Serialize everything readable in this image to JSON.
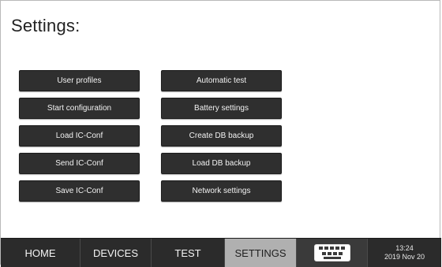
{
  "page": {
    "title": "Settings:"
  },
  "buttons": {
    "left": [
      "User profiles",
      "Start configuration",
      "Load IC-Conf",
      "Send IC-Conf",
      "Save IC-Conf"
    ],
    "right": [
      "Automatic test",
      "Battery settings",
      "Create DB backup",
      "Load DB backup",
      "Network settings"
    ]
  },
  "nav": {
    "tabs": [
      "HOME",
      "DEVICES",
      "TEST",
      "SETTINGS"
    ],
    "active_tab": "SETTINGS",
    "keyboard_icon": "keyboard-icon"
  },
  "status": {
    "time": "13:24",
    "date": "2019 Nov 20"
  },
  "colors": {
    "button_bg": "#2f2f2f",
    "nav_bg": "#2b2b2b",
    "active_tab_bg": "#b0b0b0"
  }
}
